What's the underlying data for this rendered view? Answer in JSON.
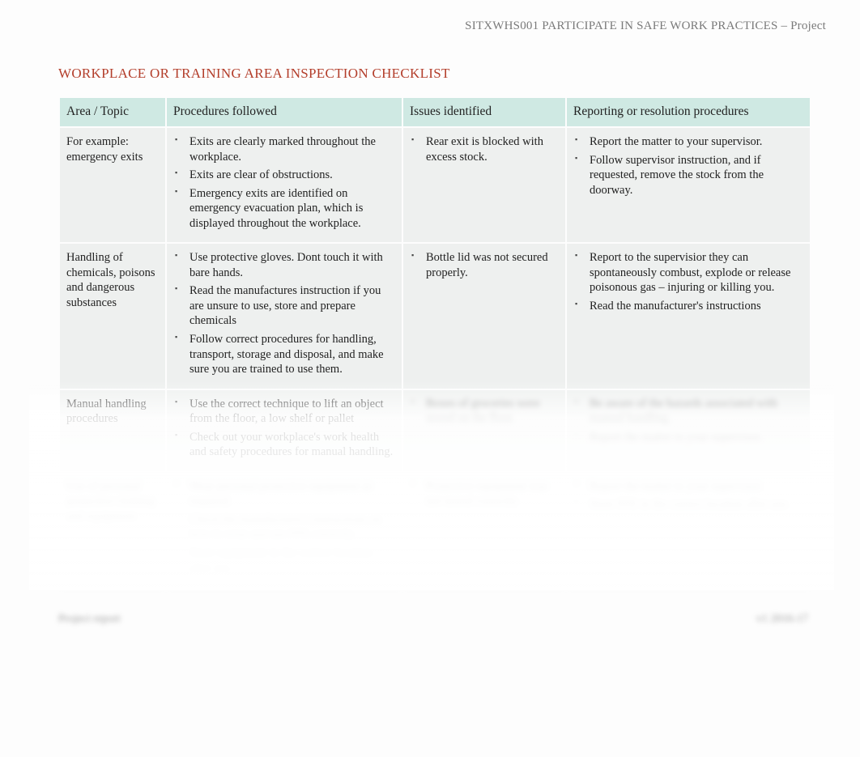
{
  "header": {
    "running": "SITXWHS001 PARTICIPATE IN SAFE WORK PRACTICES – Project"
  },
  "title": "WORKPLACE OR TRAINING AREA INSPECTION CHECKLIST",
  "columns": {
    "area": "Area / Topic",
    "procedures": "Procedures followed",
    "issues": "Issues identified",
    "reporting": "Reporting or resolution procedures"
  },
  "rows": [
    {
      "area": "For example: emergency exits",
      "procedures": [
        "Exits are clearly marked throughout the workplace.",
        "Exits are clear of obstructions.",
        "Emergency exits are identified on emergency evacuation plan, which is displayed throughout the workplace."
      ],
      "issues": [
        "Rear exit is blocked with excess stock."
      ],
      "reporting": [
        "Report the matter to your supervisor.",
        "Follow supervisor instruction, and if requested, remove the stock from the doorway."
      ]
    },
    {
      "area": "Handling of chemicals, poisons and dangerous substances",
      "procedures": [
        "Use protective gloves. Dont touch it with bare hands.",
        "Read the manufactures instruction if you are unsure to use, store and prepare chemicals",
        "Follow correct procedures for handling, transport, storage and disposal, and make sure you are trained to use them."
      ],
      "issues": [
        "Bottle lid was not secured properly."
      ],
      "reporting": [
        "Report to the supervisior they can spontaneously combust, explode or release poisonous gas – injuring or killing you.",
        "Read the manufacturer's instructions"
      ]
    },
    {
      "area": "Manual handling procedures",
      "procedures": [
        "Use the correct technique to lift an object from the floor, a low shelf or pallet",
        "Check out your workplace's work health and safety procedures for manual handling."
      ],
      "issues": [
        "Boxes of groceries were stored on the floor."
      ],
      "reporting": [
        "Be aware of the hazards associated with manual handling.",
        "Report the matter to your supervisor."
      ]
    },
    {
      "area": "Use of personal protective clothing and equipment",
      "procedures": [
        "Wear personal protective equipment as required.",
        "Check the manufacturer's instructions on how to wear and use PPE correctly.",
        "Store equipment in the correct location after use."
      ],
      "issues": [
        "Protective equipment was not stored correctly."
      ],
      "reporting": [
        "Report the matter to your supervisor.",
        "Store PPE in the correct location after use."
      ]
    }
  ],
  "footer": {
    "left": "Project report",
    "right": "v1 2016-17"
  }
}
